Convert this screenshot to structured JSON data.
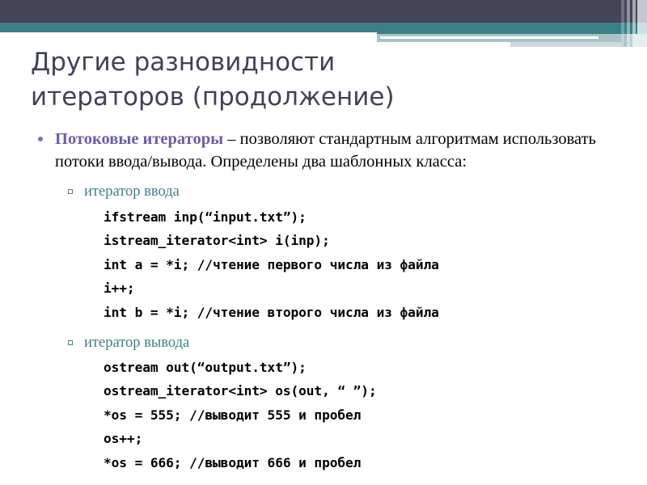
{
  "slide": {
    "title": "Другие разновидности итераторов (продолжение)",
    "colors": {
      "header_dark": "#434557",
      "header_teal": "#3d7f87",
      "header_pale": "#8fb6bb",
      "title_text": "#3f4257",
      "lead_purple": "#6f5ba6",
      "bullet_purple": "#8e6ba8",
      "subbullet_teal": "#3f7f86",
      "code_text": "#000000",
      "background": "#ffffff"
    },
    "bullets": [
      {
        "marker": "disc-bullet",
        "lead": "Потоковые итераторы",
        "rest": " – позволяют стандартным алгоритмам использовать потоки ввода/вывода. Определены два шаблонных класса:"
      }
    ],
    "sections": [
      {
        "marker": "square-bullet",
        "label": "итератор ввода",
        "code": [
          "ifstream inp(“input.txt”);",
          "istream_iterator<int> i(inp);",
          "int a = *i; //чтение первого числа из файла",
          "i++;",
          "int b = *i; //чтение второго числа из файла"
        ]
      },
      {
        "marker": "square-bullet",
        "label": "итератор вывода",
        "code": [
          "ostream out(“output.txt”);",
          "ostream_iterator<int> os(out, “ ”);",
          "*os = 555; //выводит 555 и пробел",
          "os++;",
          "*os = 666; //выводит 666 и пробел"
        ]
      }
    ]
  }
}
